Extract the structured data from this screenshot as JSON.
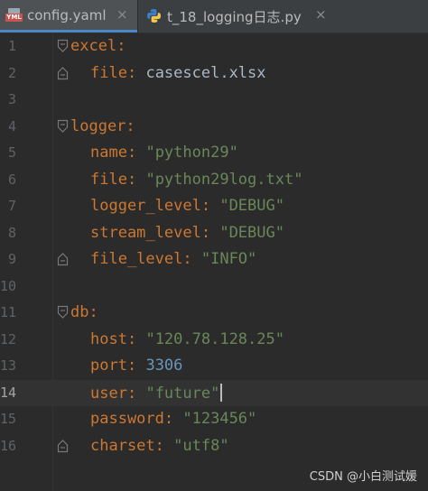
{
  "tabs": [
    {
      "icon": "yaml-file-icon",
      "icon_text": "YML",
      "label": "config.yaml",
      "active": true
    },
    {
      "icon": "python-file-icon",
      "label": "t_18_logging日志.py",
      "active": false
    }
  ],
  "close_glyph": "×",
  "current_line": 14,
  "lines": [
    {
      "num": "1",
      "key": "excel",
      "value": ""
    },
    {
      "num": "2",
      "key": "file",
      "value": "casescel.xlsx"
    },
    {
      "num": "3",
      "key": "",
      "value": ""
    },
    {
      "num": "4",
      "key": "logger",
      "value": ""
    },
    {
      "num": "5",
      "key": "name",
      "value": "\"python29\""
    },
    {
      "num": "6",
      "key": "file",
      "value": "\"python29log.txt\""
    },
    {
      "num": "7",
      "key": "logger_level",
      "value": "\"DEBUG\""
    },
    {
      "num": "8",
      "key": "stream_level",
      "value": "\"DEBUG\""
    },
    {
      "num": "9",
      "key": "file_level",
      "value": "\"INFO\""
    },
    {
      "num": "10",
      "key": "",
      "value": ""
    },
    {
      "num": "11",
      "key": "db",
      "value": ""
    },
    {
      "num": "12",
      "key": "host",
      "value": "\"120.78.128.25\""
    },
    {
      "num": "13",
      "key": "port",
      "value": "3306"
    },
    {
      "num": "14",
      "key": "user",
      "value": "\"future\""
    },
    {
      "num": "15",
      "key": "password",
      "value": "\"123456\""
    },
    {
      "num": "16",
      "key": "charset",
      "value": "\"utf8\""
    }
  ],
  "colon": ":",
  "watermark": "CSDN @小白测试媛",
  "colors": {
    "background": "#2b2b2b",
    "key": "#cc7832",
    "string": "#6a8759",
    "number": "#6897bb",
    "plain": "#a9b7c6",
    "line_number": "#606366",
    "current_line": "#323232"
  }
}
